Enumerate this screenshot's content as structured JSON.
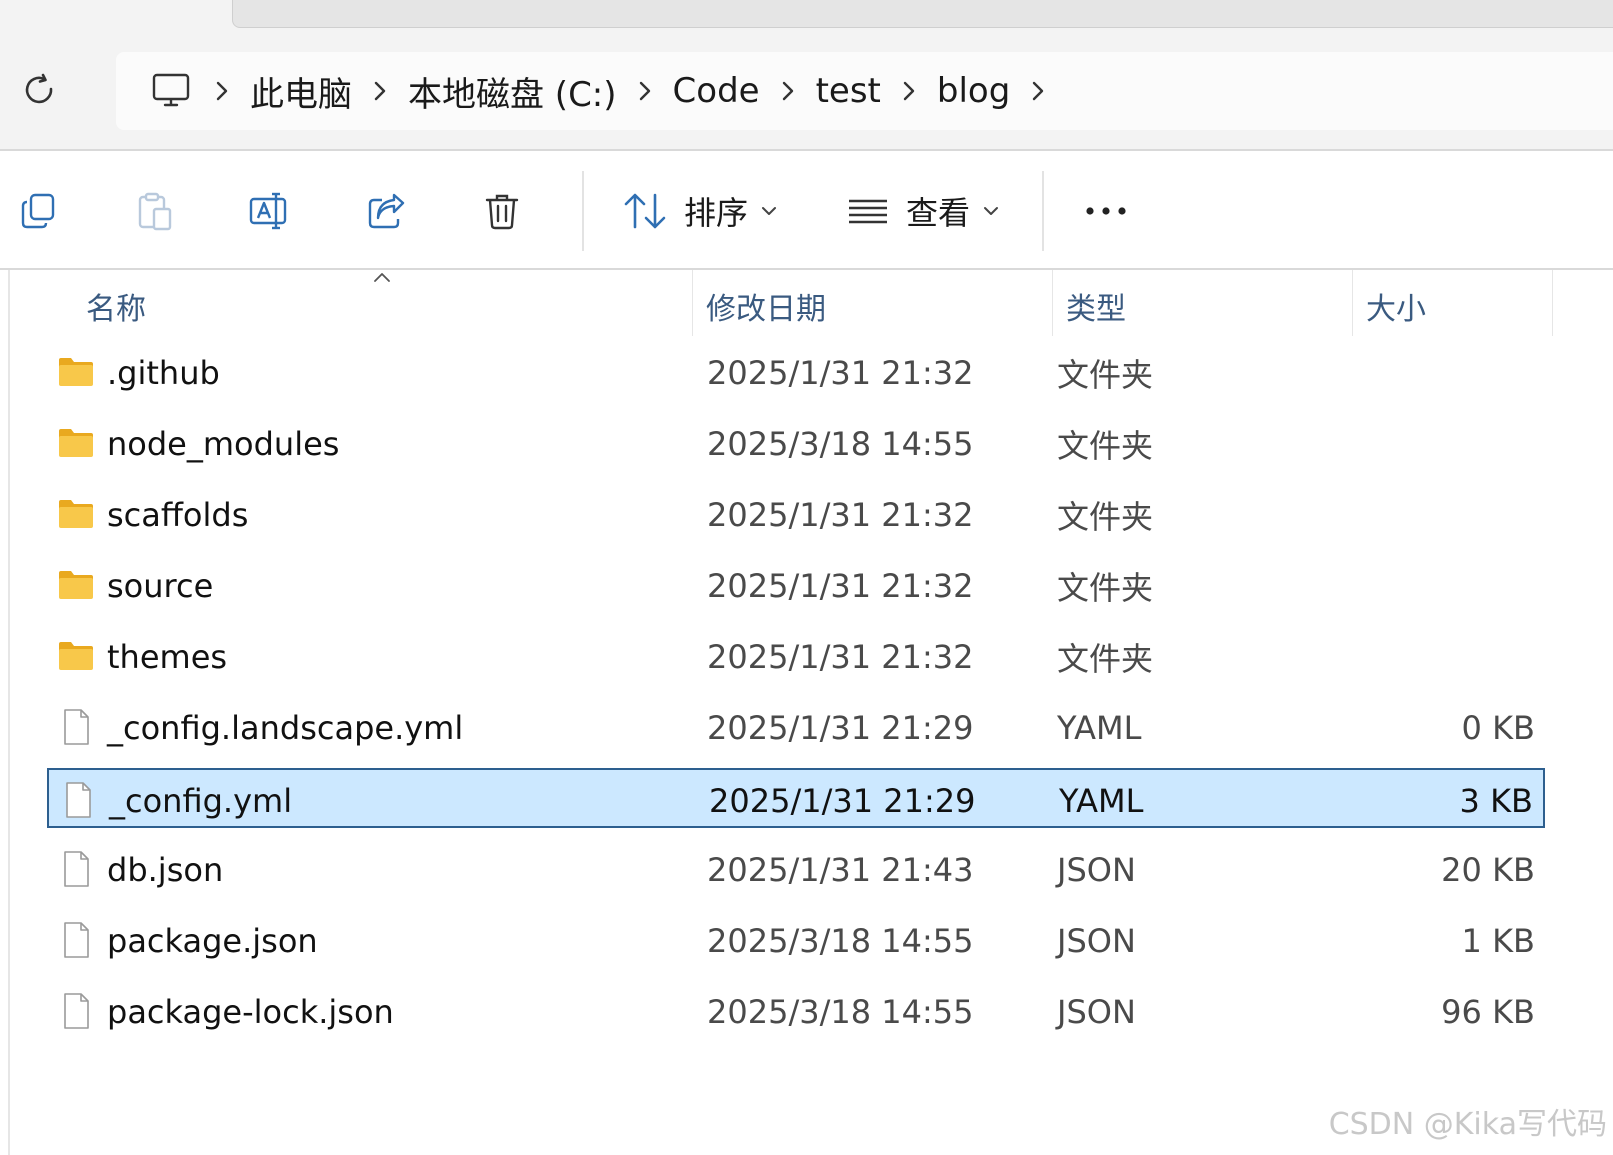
{
  "address": {
    "breadcrumbs": [
      "此电脑",
      "本地磁盘 (C:)",
      "Code",
      "test",
      "blog"
    ]
  },
  "toolbar": {
    "sort_label": "排序",
    "view_label": "查看"
  },
  "columns": {
    "name": "名称",
    "modified": "修改日期",
    "type": "类型",
    "size": "大小"
  },
  "files": [
    {
      "name": ".github",
      "modified": "2025/1/31 21:32",
      "type": "文件夹",
      "size": "",
      "kind": "folder"
    },
    {
      "name": "node_modules",
      "modified": "2025/3/18 14:55",
      "type": "文件夹",
      "size": "",
      "kind": "folder"
    },
    {
      "name": "scaffolds",
      "modified": "2025/1/31 21:32",
      "type": "文件夹",
      "size": "",
      "kind": "folder"
    },
    {
      "name": "source",
      "modified": "2025/1/31 21:32",
      "type": "文件夹",
      "size": "",
      "kind": "folder"
    },
    {
      "name": "themes",
      "modified": "2025/1/31 21:32",
      "type": "文件夹",
      "size": "",
      "kind": "folder"
    },
    {
      "name": "_config.landscape.yml",
      "modified": "2025/1/31 21:29",
      "type": "YAML",
      "size": "0 KB",
      "kind": "file"
    },
    {
      "name": "_config.yml",
      "modified": "2025/1/31 21:29",
      "type": "YAML",
      "size": "3 KB",
      "kind": "file",
      "selected": true
    },
    {
      "name": "db.json",
      "modified": "2025/1/31 21:43",
      "type": "JSON",
      "size": "20 KB",
      "kind": "file"
    },
    {
      "name": "package.json",
      "modified": "2025/3/18 14:55",
      "type": "JSON",
      "size": "1 KB",
      "kind": "file"
    },
    {
      "name": "package-lock.json",
      "modified": "2025/3/18 14:55",
      "type": "JSON",
      "size": "96 KB",
      "kind": "file"
    }
  ],
  "watermark": "CSDN @Kika写代码",
  "colors": {
    "selection_bg": "#cce8ff",
    "selection_border": "#2d5f8f",
    "accent_blue": "#2f6fb3",
    "folder_yellow": "#f8c84a"
  },
  "icons": {
    "refresh": "refresh-icon",
    "computer": "computer-icon",
    "copy": "copy-icon",
    "paste": "paste-icon",
    "rename": "rename-icon",
    "share": "share-icon",
    "delete": "trash-icon",
    "sort": "sort-arrows-icon",
    "view": "view-lines-icon",
    "more": "more-icon",
    "folder": "folder-icon",
    "file": "file-icon"
  }
}
